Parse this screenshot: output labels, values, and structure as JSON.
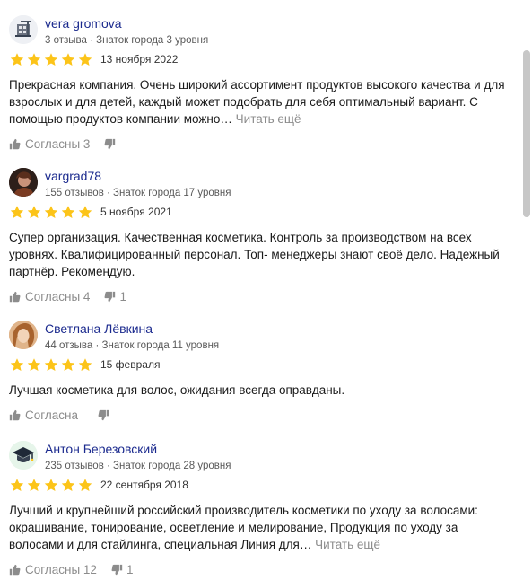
{
  "reviews": [
    {
      "author": "vera gromova",
      "stats": "3 отзыва · Знаток города 3 уровня",
      "avatar_icon": "building-crane-icon",
      "rating": 5,
      "date": "13 ноября 2022",
      "text": "Прекрасная компания. Очень широкий ассортимент продуктов высокого качества и для взрослых и для детей, каждый может подобрать для себя оптимальный вариант. С помощью продуктов компании можно…",
      "read_more": "Читать ещё",
      "like_label": "Согласны 3",
      "dislike_count": ""
    },
    {
      "author": "vargrad78",
      "stats": "155 отзывов · Знаток города 17 уровня",
      "avatar_icon": "user-photo",
      "rating": 5,
      "date": "5 ноября 2021",
      "text": "Супер организация. Качественная косметика. Контроль за производством на всех уровнях. Квалифицированный персонал. Топ- менеджеры знают своё дело. Надежный партнёр. Рекомендую.",
      "read_more": "",
      "like_label": "Согласны 4",
      "dislike_count": "1"
    },
    {
      "author": "Светлана Лёвкина",
      "stats": "44 отзыва · Знаток города 11 уровня",
      "avatar_icon": "user-photo",
      "rating": 5,
      "date": "15 февраля",
      "text": "Лучшая косметика для волос, ожидания всегда оправданы.",
      "read_more": "",
      "like_label": "Согласна",
      "dislike_count": ""
    },
    {
      "author": "Антон Березовский",
      "stats": "235 отзывов · Знаток города 28 уровня",
      "avatar_icon": "graduation-cap-icon",
      "rating": 5,
      "date": "22 сентября 2018",
      "text": "Лучший и крупнейший российский производитель косметики по уходу за волосами: окрашивание, тонирование, осветление и мелирование, Продукция по уходу за волосами и для стайлинга, специальная Линия для…",
      "read_more": "Читать ещё",
      "like_label": "Согласны 12",
      "dislike_count": "1"
    }
  ],
  "colors": {
    "star": "#fcc419",
    "author_link": "#1b2a8e",
    "muted": "#8c8c8c"
  }
}
